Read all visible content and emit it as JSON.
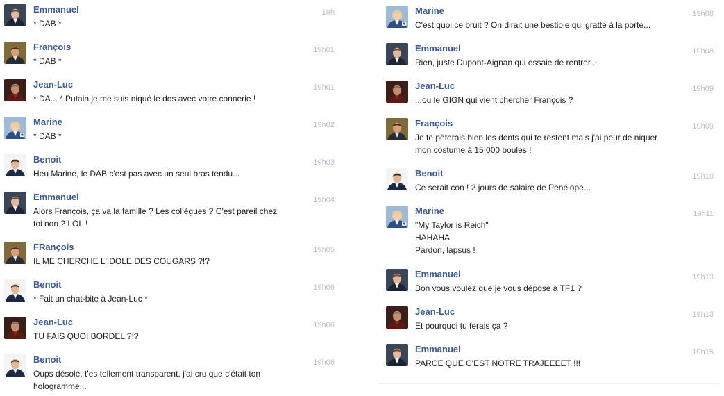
{
  "conversation": {
    "left_column": [
      {
        "sender": "Emmanuel",
        "avatar": "emmanuel-avatar",
        "time": "19h",
        "lines": [
          "* DAB *"
        ]
      },
      {
        "sender": "François",
        "avatar": "francois-avatar",
        "time": "19h01",
        "lines": [
          "* DAB *"
        ]
      },
      {
        "sender": "Jean-Luc",
        "avatar": "jean-luc-avatar",
        "time": "19h01",
        "lines": [
          "* DA... * Putain je me suis niqué le dos avec votre connerie !"
        ]
      },
      {
        "sender": "Marine",
        "avatar": "marine-avatar",
        "time": "19h02",
        "lines": [
          "* DAB *"
        ]
      },
      {
        "sender": "Benoit",
        "avatar": "benoit-avatar",
        "time": "19h03",
        "lines": [
          "Heu Marine, le DAB c'est pas avec un seul bras tendu..."
        ]
      },
      {
        "sender": "Emmanuel",
        "avatar": "emmanuel-avatar",
        "time": "19h04",
        "lines": [
          "Alors François, ça va la famille ? Les collègues ? C'est pareil chez",
          "toi non ? LOL !"
        ]
      },
      {
        "sender": "FRançois",
        "avatar": "francois-avatar",
        "time": "19h05",
        "lines": [
          "IL ME CHERCHE L'IDOLE DES COUGARS ?!?"
        ]
      },
      {
        "sender": "Benoit",
        "avatar": "benoit-avatar",
        "time": "19h06",
        "lines": [
          "* Fait un chat-bite à Jean-Luc *"
        ]
      },
      {
        "sender": "Jean-Luc",
        "avatar": "jean-luc-avatar",
        "time": "19h06",
        "lines": [
          "TU FAIS QUOI BORDEL ?!?"
        ]
      },
      {
        "sender": "Benoit",
        "avatar": "benoit-avatar",
        "time": "19h06",
        "lines": [
          "Oups désolé, t'es tellement transparent, j'ai cru que c'était ton",
          "hologramme..."
        ]
      }
    ],
    "right_column": [
      {
        "sender": "Marine",
        "avatar": "marine-avatar",
        "time": "19h08",
        "lines": [
          "C'est quoi ce bruit ? On dirait une bestiole qui gratte à la porte..."
        ]
      },
      {
        "sender": "Emmanuel",
        "avatar": "emmanuel-avatar",
        "time": "19h08",
        "lines": [
          "Rien, juste Dupont-Aignan qui essaie de rentrer..."
        ]
      },
      {
        "sender": "Jean-Luc",
        "avatar": "jean-luc-avatar",
        "time": "19h09",
        "lines": [
          "...ou le GIGN qui vient chercher François ?"
        ]
      },
      {
        "sender": "François",
        "avatar": "francois-avatar",
        "time": "19h09",
        "lines": [
          "Je te pèterais bien les dents qui te restent mais j'ai peur de niquer",
          "mon costume à 15 000 boules !"
        ]
      },
      {
        "sender": "Benoit",
        "avatar": "benoit-avatar",
        "time": "19h10",
        "lines": [
          "Ce serait con ! 2 jours de salaire de Pénélope..."
        ]
      },
      {
        "sender": "Marine",
        "avatar": "marine-avatar",
        "time": "19h11",
        "lines": [
          "\"My Taylor is Reich\"",
          "HAHAHA",
          "Pardon, lapsus !"
        ]
      },
      {
        "sender": "Emmanuel",
        "avatar": "emmanuel-avatar",
        "time": "19h13",
        "lines": [
          "Bon vous voulez que je vous dépose à TF1 ?"
        ]
      },
      {
        "sender": "Jean-Luc",
        "avatar": "jean-luc-avatar",
        "time": "19h13",
        "lines": [
          "Et pourquoi tu ferais ça ?"
        ]
      },
      {
        "sender": "Emmanuel",
        "avatar": "emmanuel-avatar",
        "time": "19h15",
        "lines": [
          "PARCE QUE C'EST NOTRE TRAJEEEET !!!"
        ]
      }
    ]
  },
  "colors": {
    "sender_name": "#3b5998",
    "message_text": "#222222",
    "timestamp": "#b9bfca",
    "background": "#ffffff"
  }
}
